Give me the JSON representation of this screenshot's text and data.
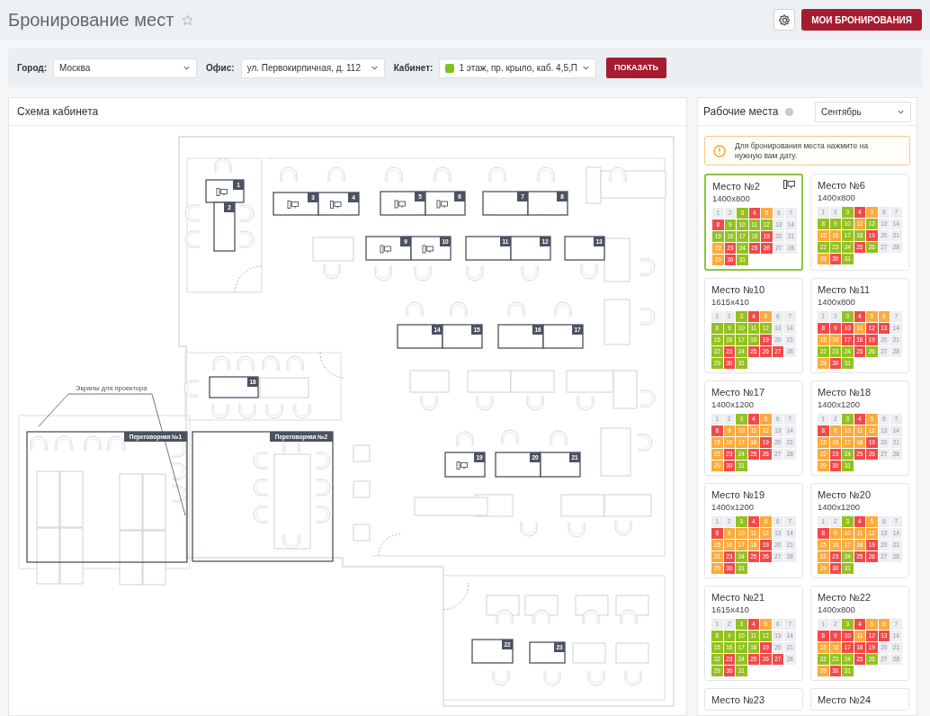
{
  "page": {
    "title": "Бронирование мест",
    "favorite": false,
    "my_bookings_button": "МОИ БРОНИРОВАНИЯ"
  },
  "filters": [
    {
      "label": "Город:",
      "value": "Москва"
    },
    {
      "label": "Офис:",
      "value": "ул. Первокирпичная, д. 112"
    },
    {
      "label": "Кабинет:",
      "value": "1 этаж, пр. крыло, каб. 4,5,П",
      "color": "#7cc520"
    }
  ],
  "show_button": "ПОКАЗАТЬ",
  "plan": {
    "title": "Схема кабинета",
    "annotation": "Экраны для проектора",
    "rooms": [
      {
        "label": "Переговорная №1"
      },
      {
        "label": "Переговорная №2"
      }
    ],
    "desks": [
      {
        "number": "1",
        "monitor": true
      },
      {
        "number": "2",
        "monitor": false
      },
      {
        "number": "3",
        "monitor": true
      },
      {
        "number": "4",
        "monitor": true
      },
      {
        "number": "5",
        "monitor": true
      },
      {
        "number": "6",
        "monitor": true
      },
      {
        "number": "7",
        "monitor": false
      },
      {
        "number": "8",
        "monitor": false
      },
      {
        "number": "9",
        "monitor": true
      },
      {
        "number": "10",
        "monitor": true
      },
      {
        "number": "11",
        "monitor": false
      },
      {
        "number": "12",
        "monitor": false
      },
      {
        "number": "13",
        "monitor": false
      },
      {
        "number": "14",
        "monitor": false
      },
      {
        "number": "15",
        "monitor": false
      },
      {
        "number": "16",
        "monitor": false
      },
      {
        "number": "17",
        "monitor": false
      },
      {
        "number": "18",
        "monitor": false
      },
      {
        "number": "19",
        "monitor": true
      },
      {
        "number": "20",
        "monitor": false
      },
      {
        "number": "21",
        "monitor": false
      },
      {
        "number": "22",
        "monitor": false
      },
      {
        "number": "23",
        "monitor": false
      }
    ]
  },
  "workplaces": {
    "title": "Рабочие места",
    "month": "Сентябрь",
    "notice": "Для бронирования места нажмите на нужную вам дату.",
    "cards": [
      {
        "title": "Место №2",
        "size": "1400x800",
        "selected": true,
        "monitor": true,
        "days": [
          {
            "n": "1",
            "color": "#eceef1"
          },
          {
            "n": "2",
            "color": "#eceef1"
          },
          {
            "n": "3",
            "color": "#94c11f"
          },
          {
            "n": "4",
            "color": "#f24a4a"
          },
          {
            "n": "5",
            "color": "#fbab3c"
          },
          {
            "n": "6",
            "color": "#eceef1"
          },
          {
            "n": "7",
            "color": "#eceef1"
          },
          {
            "n": "8",
            "color": "#f24a4a"
          },
          {
            "n": "9",
            "color": "#94c11f"
          },
          {
            "n": "10",
            "color": "#94c11f"
          },
          {
            "n": "11",
            "color": "#94c11f"
          },
          {
            "n": "12",
            "color": "#94c11f"
          },
          {
            "n": "13",
            "color": "#eceef1"
          },
          {
            "n": "14",
            "color": "#eceef1"
          },
          {
            "n": "15",
            "color": "#94c11f"
          },
          {
            "n": "16",
            "color": "#94c11f"
          },
          {
            "n": "17",
            "color": "#94c11f"
          },
          {
            "n": "18",
            "color": "#94c11f"
          },
          {
            "n": "19",
            "color": "#f24a4a"
          },
          {
            "n": "20",
            "color": "#eceef1"
          },
          {
            "n": "21",
            "color": "#eceef1"
          },
          {
            "n": "22",
            "color": "#fbab3c"
          },
          {
            "n": "23",
            "color": "#f24a4a"
          },
          {
            "n": "24",
            "color": "#94c11f"
          },
          {
            "n": "25",
            "color": "#f24a4a"
          },
          {
            "n": "26",
            "color": "#f24a4a"
          },
          {
            "n": "27",
            "color": "#eceef1"
          },
          {
            "n": "28",
            "color": "#eceef1"
          },
          {
            "n": "29",
            "color": "#fbab3c"
          },
          {
            "n": "30",
            "color": "#f24a4a"
          },
          {
            "n": "31",
            "color": "#94c11f"
          }
        ]
      },
      {
        "title": "Место №6",
        "size": "1400x800",
        "selected": false,
        "monitor": false,
        "days": [
          {
            "n": "1",
            "color": "#eceef1"
          },
          {
            "n": "2",
            "color": "#eceef1"
          },
          {
            "n": "3",
            "color": "#94c11f"
          },
          {
            "n": "4",
            "color": "#f24a4a"
          },
          {
            "n": "5",
            "color": "#fbab3c"
          },
          {
            "n": "6",
            "color": "#eceef1"
          },
          {
            "n": "7",
            "color": "#eceef1"
          },
          {
            "n": "8",
            "color": "#94c11f"
          },
          {
            "n": "9",
            "color": "#94c11f"
          },
          {
            "n": "10",
            "color": "#94c11f"
          },
          {
            "n": "11",
            "color": "#fbab3c"
          },
          {
            "n": "12",
            "color": "#94c11f"
          },
          {
            "n": "13",
            "color": "#eceef1"
          },
          {
            "n": "14",
            "color": "#eceef1"
          },
          {
            "n": "15",
            "color": "#fbab3c"
          },
          {
            "n": "16",
            "color": "#fbab3c"
          },
          {
            "n": "17",
            "color": "#94c11f"
          },
          {
            "n": "18",
            "color": "#94c11f"
          },
          {
            "n": "19",
            "color": "#f24a4a"
          },
          {
            "n": "20",
            "color": "#eceef1"
          },
          {
            "n": "21",
            "color": "#eceef1"
          },
          {
            "n": "22",
            "color": "#94c11f"
          },
          {
            "n": "23",
            "color": "#94c11f"
          },
          {
            "n": "24",
            "color": "#94c11f"
          },
          {
            "n": "25",
            "color": "#f24a4a"
          },
          {
            "n": "26",
            "color": "#94c11f"
          },
          {
            "n": "27",
            "color": "#eceef1"
          },
          {
            "n": "28",
            "color": "#eceef1"
          },
          {
            "n": "29",
            "color": "#fbab3c"
          },
          {
            "n": "30",
            "color": "#f24a4a"
          },
          {
            "n": "31",
            "color": "#94c11f"
          }
        ]
      },
      {
        "title": "Место №10",
        "size": "1615x410",
        "selected": false,
        "monitor": false,
        "days": [
          {
            "n": "1",
            "color": "#eceef1"
          },
          {
            "n": "2",
            "color": "#eceef1"
          },
          {
            "n": "3",
            "color": "#94c11f"
          },
          {
            "n": "4",
            "color": "#f24a4a"
          },
          {
            "n": "5",
            "color": "#fbab3c"
          },
          {
            "n": "6",
            "color": "#eceef1"
          },
          {
            "n": "7",
            "color": "#eceef1"
          },
          {
            "n": "8",
            "color": "#94c11f"
          },
          {
            "n": "9",
            "color": "#94c11f"
          },
          {
            "n": "10",
            "color": "#94c11f"
          },
          {
            "n": "11",
            "color": "#94c11f"
          },
          {
            "n": "12",
            "color": "#94c11f"
          },
          {
            "n": "13",
            "color": "#eceef1"
          },
          {
            "n": "14",
            "color": "#eceef1"
          },
          {
            "n": "15",
            "color": "#94c11f"
          },
          {
            "n": "16",
            "color": "#94c11f"
          },
          {
            "n": "17",
            "color": "#94c11f"
          },
          {
            "n": "18",
            "color": "#94c11f"
          },
          {
            "n": "19",
            "color": "#f24a4a"
          },
          {
            "n": "20",
            "color": "#eceef1"
          },
          {
            "n": "21",
            "color": "#eceef1"
          },
          {
            "n": "22",
            "color": "#94c11f"
          },
          {
            "n": "23",
            "color": "#f24a4a"
          },
          {
            "n": "24",
            "color": "#94c11f"
          },
          {
            "n": "25",
            "color": "#f24a4a"
          },
          {
            "n": "26",
            "color": "#f24a4a"
          },
          {
            "n": "27",
            "color": "#f24a4a"
          },
          {
            "n": "28",
            "color": "#eceef1"
          },
          {
            "n": "29",
            "color": "#94c11f"
          },
          {
            "n": "30",
            "color": "#f24a4a"
          },
          {
            "n": "31",
            "color": "#94c11f"
          }
        ]
      },
      {
        "title": "Место №11",
        "size": "1400x800",
        "selected": false,
        "monitor": false,
        "days": [
          {
            "n": "1",
            "color": "#eceef1"
          },
          {
            "n": "2",
            "color": "#eceef1"
          },
          {
            "n": "3",
            "color": "#94c11f"
          },
          {
            "n": "4",
            "color": "#f24a4a"
          },
          {
            "n": "5",
            "color": "#fbab3c"
          },
          {
            "n": "6",
            "color": "#fbab3c"
          },
          {
            "n": "7",
            "color": "#eceef1"
          },
          {
            "n": "8",
            "color": "#f24a4a"
          },
          {
            "n": "9",
            "color": "#f24a4a"
          },
          {
            "n": "10",
            "color": "#f24a4a"
          },
          {
            "n": "11",
            "color": "#fbab3c"
          },
          {
            "n": "12",
            "color": "#f24a4a"
          },
          {
            "n": "13",
            "color": "#f24a4a"
          },
          {
            "n": "14",
            "color": "#eceef1"
          },
          {
            "n": "15",
            "color": "#fbab3c"
          },
          {
            "n": "16",
            "color": "#fbab3c"
          },
          {
            "n": "17",
            "color": "#f24a4a"
          },
          {
            "n": "18",
            "color": "#f24a4a"
          },
          {
            "n": "19",
            "color": "#f24a4a"
          },
          {
            "n": "20",
            "color": "#eceef1"
          },
          {
            "n": "21",
            "color": "#eceef1"
          },
          {
            "n": "22",
            "color": "#94c11f"
          },
          {
            "n": "23",
            "color": "#94c11f"
          },
          {
            "n": "24",
            "color": "#94c11f"
          },
          {
            "n": "25",
            "color": "#f24a4a"
          },
          {
            "n": "26",
            "color": "#94c11f"
          },
          {
            "n": "27",
            "color": "#eceef1"
          },
          {
            "n": "28",
            "color": "#eceef1"
          },
          {
            "n": "29",
            "color": "#fbab3c"
          },
          {
            "n": "30",
            "color": "#f24a4a"
          },
          {
            "n": "31",
            "color": "#94c11f"
          }
        ]
      },
      {
        "title": "Место №17",
        "size": "1400x1200",
        "selected": false,
        "monitor": false,
        "days": [
          {
            "n": "1",
            "color": "#eceef1"
          },
          {
            "n": "2",
            "color": "#eceef1"
          },
          {
            "n": "3",
            "color": "#94c11f"
          },
          {
            "n": "4",
            "color": "#f24a4a"
          },
          {
            "n": "5",
            "color": "#fbab3c"
          },
          {
            "n": "6",
            "color": "#eceef1"
          },
          {
            "n": "7",
            "color": "#eceef1"
          },
          {
            "n": "8",
            "color": "#f24a4a"
          },
          {
            "n": "9",
            "color": "#fbab3c"
          },
          {
            "n": "10",
            "color": "#fbab3c"
          },
          {
            "n": "11",
            "color": "#fbab3c"
          },
          {
            "n": "12",
            "color": "#fbab3c"
          },
          {
            "n": "13",
            "color": "#eceef1"
          },
          {
            "n": "14",
            "color": "#eceef1"
          },
          {
            "n": "15",
            "color": "#fbab3c"
          },
          {
            "n": "16",
            "color": "#fbab3c"
          },
          {
            "n": "17",
            "color": "#fbab3c"
          },
          {
            "n": "18",
            "color": "#fbab3c"
          },
          {
            "n": "19",
            "color": "#f24a4a"
          },
          {
            "n": "20",
            "color": "#eceef1"
          },
          {
            "n": "21",
            "color": "#eceef1"
          },
          {
            "n": "22",
            "color": "#fbab3c"
          },
          {
            "n": "23",
            "color": "#f24a4a"
          },
          {
            "n": "24",
            "color": "#94c11f"
          },
          {
            "n": "25",
            "color": "#f24a4a"
          },
          {
            "n": "26",
            "color": "#f24a4a"
          },
          {
            "n": "27",
            "color": "#eceef1"
          },
          {
            "n": "28",
            "color": "#eceef1"
          },
          {
            "n": "29",
            "color": "#fbab3c"
          },
          {
            "n": "30",
            "color": "#f24a4a"
          },
          {
            "n": "31",
            "color": "#94c11f"
          }
        ]
      },
      {
        "title": "Место №18",
        "size": "1400x1200",
        "selected": false,
        "monitor": false,
        "days": [
          {
            "n": "1",
            "color": "#eceef1"
          },
          {
            "n": "2",
            "color": "#eceef1"
          },
          {
            "n": "3",
            "color": "#94c11f"
          },
          {
            "n": "4",
            "color": "#f24a4a"
          },
          {
            "n": "5",
            "color": "#fbab3c"
          },
          {
            "n": "6",
            "color": "#eceef1"
          },
          {
            "n": "7",
            "color": "#eceef1"
          },
          {
            "n": "8",
            "color": "#f24a4a"
          },
          {
            "n": "9",
            "color": "#fbab3c"
          },
          {
            "n": "10",
            "color": "#fbab3c"
          },
          {
            "n": "11",
            "color": "#fbab3c"
          },
          {
            "n": "12",
            "color": "#fbab3c"
          },
          {
            "n": "13",
            "color": "#eceef1"
          },
          {
            "n": "14",
            "color": "#eceef1"
          },
          {
            "n": "15",
            "color": "#fbab3c"
          },
          {
            "n": "16",
            "color": "#fbab3c"
          },
          {
            "n": "17",
            "color": "#fbab3c"
          },
          {
            "n": "18",
            "color": "#fbab3c"
          },
          {
            "n": "19",
            "color": "#f24a4a"
          },
          {
            "n": "20",
            "color": "#eceef1"
          },
          {
            "n": "21",
            "color": "#eceef1"
          },
          {
            "n": "22",
            "color": "#fbab3c"
          },
          {
            "n": "23",
            "color": "#f24a4a"
          },
          {
            "n": "24",
            "color": "#94c11f"
          },
          {
            "n": "25",
            "color": "#f24a4a"
          },
          {
            "n": "26",
            "color": "#f24a4a"
          },
          {
            "n": "27",
            "color": "#eceef1"
          },
          {
            "n": "28",
            "color": "#eceef1"
          },
          {
            "n": "29",
            "color": "#fbab3c"
          },
          {
            "n": "30",
            "color": "#f24a4a"
          },
          {
            "n": "31",
            "color": "#94c11f"
          }
        ]
      },
      {
        "title": "Место №19",
        "size": "1400x1200",
        "selected": false,
        "monitor": false,
        "days": [
          {
            "n": "1",
            "color": "#eceef1"
          },
          {
            "n": "2",
            "color": "#eceef1"
          },
          {
            "n": "3",
            "color": "#94c11f"
          },
          {
            "n": "4",
            "color": "#f24a4a"
          },
          {
            "n": "5",
            "color": "#fbab3c"
          },
          {
            "n": "6",
            "color": "#eceef1"
          },
          {
            "n": "7",
            "color": "#eceef1"
          },
          {
            "n": "8",
            "color": "#f24a4a"
          },
          {
            "n": "9",
            "color": "#fbab3c"
          },
          {
            "n": "10",
            "color": "#fbab3c"
          },
          {
            "n": "11",
            "color": "#fbab3c"
          },
          {
            "n": "12",
            "color": "#fbab3c"
          },
          {
            "n": "13",
            "color": "#eceef1"
          },
          {
            "n": "14",
            "color": "#eceef1"
          },
          {
            "n": "15",
            "color": "#fbab3c"
          },
          {
            "n": "16",
            "color": "#fbab3c"
          },
          {
            "n": "17",
            "color": "#fbab3c"
          },
          {
            "n": "18",
            "color": "#fbab3c"
          },
          {
            "n": "19",
            "color": "#f24a4a"
          },
          {
            "n": "20",
            "color": "#eceef1"
          },
          {
            "n": "21",
            "color": "#eceef1"
          },
          {
            "n": "22",
            "color": "#fbab3c"
          },
          {
            "n": "23",
            "color": "#f24a4a"
          },
          {
            "n": "24",
            "color": "#94c11f"
          },
          {
            "n": "25",
            "color": "#f24a4a"
          },
          {
            "n": "26",
            "color": "#f24a4a"
          },
          {
            "n": "27",
            "color": "#eceef1"
          },
          {
            "n": "28",
            "color": "#eceef1"
          },
          {
            "n": "29",
            "color": "#fbab3c"
          },
          {
            "n": "30",
            "color": "#f24a4a"
          },
          {
            "n": "31",
            "color": "#94c11f"
          }
        ]
      },
      {
        "title": "Место №20",
        "size": "1400x1200",
        "selected": false,
        "monitor": false,
        "days": [
          {
            "n": "1",
            "color": "#eceef1"
          },
          {
            "n": "2",
            "color": "#eceef1"
          },
          {
            "n": "3",
            "color": "#94c11f"
          },
          {
            "n": "4",
            "color": "#f24a4a"
          },
          {
            "n": "5",
            "color": "#fbab3c"
          },
          {
            "n": "6",
            "color": "#eceef1"
          },
          {
            "n": "7",
            "color": "#eceef1"
          },
          {
            "n": "8",
            "color": "#f24a4a"
          },
          {
            "n": "9",
            "color": "#fbab3c"
          },
          {
            "n": "10",
            "color": "#fbab3c"
          },
          {
            "n": "11",
            "color": "#fbab3c"
          },
          {
            "n": "12",
            "color": "#fbab3c"
          },
          {
            "n": "13",
            "color": "#eceef1"
          },
          {
            "n": "14",
            "color": "#eceef1"
          },
          {
            "n": "15",
            "color": "#fbab3c"
          },
          {
            "n": "16",
            "color": "#fbab3c"
          },
          {
            "n": "17",
            "color": "#fbab3c"
          },
          {
            "n": "18",
            "color": "#fbab3c"
          },
          {
            "n": "19",
            "color": "#f24a4a"
          },
          {
            "n": "20",
            "color": "#eceef1"
          },
          {
            "n": "21",
            "color": "#eceef1"
          },
          {
            "n": "22",
            "color": "#fbab3c"
          },
          {
            "n": "23",
            "color": "#f24a4a"
          },
          {
            "n": "24",
            "color": "#94c11f"
          },
          {
            "n": "25",
            "color": "#f24a4a"
          },
          {
            "n": "26",
            "color": "#f24a4a"
          },
          {
            "n": "27",
            "color": "#eceef1"
          },
          {
            "n": "28",
            "color": "#eceef1"
          },
          {
            "n": "29",
            "color": "#fbab3c"
          },
          {
            "n": "30",
            "color": "#f24a4a"
          },
          {
            "n": "31",
            "color": "#94c11f"
          }
        ]
      },
      {
        "title": "Место №21",
        "size": "1615x410",
        "selected": false,
        "monitor": false,
        "days": [
          {
            "n": "1",
            "color": "#eceef1"
          },
          {
            "n": "2",
            "color": "#eceef1"
          },
          {
            "n": "3",
            "color": "#94c11f"
          },
          {
            "n": "4",
            "color": "#f24a4a"
          },
          {
            "n": "5",
            "color": "#fbab3c"
          },
          {
            "n": "6",
            "color": "#eceef1"
          },
          {
            "n": "7",
            "color": "#eceef1"
          },
          {
            "n": "8",
            "color": "#94c11f"
          },
          {
            "n": "9",
            "color": "#94c11f"
          },
          {
            "n": "10",
            "color": "#94c11f"
          },
          {
            "n": "11",
            "color": "#94c11f"
          },
          {
            "n": "12",
            "color": "#94c11f"
          },
          {
            "n": "13",
            "color": "#eceef1"
          },
          {
            "n": "14",
            "color": "#eceef1"
          },
          {
            "n": "15",
            "color": "#94c11f"
          },
          {
            "n": "16",
            "color": "#94c11f"
          },
          {
            "n": "17",
            "color": "#94c11f"
          },
          {
            "n": "18",
            "color": "#94c11f"
          },
          {
            "n": "19",
            "color": "#f24a4a"
          },
          {
            "n": "20",
            "color": "#eceef1"
          },
          {
            "n": "21",
            "color": "#eceef1"
          },
          {
            "n": "22",
            "color": "#94c11f"
          },
          {
            "n": "23",
            "color": "#f24a4a"
          },
          {
            "n": "24",
            "color": "#94c11f"
          },
          {
            "n": "25",
            "color": "#f24a4a"
          },
          {
            "n": "26",
            "color": "#f24a4a"
          },
          {
            "n": "27",
            "color": "#f24a4a"
          },
          {
            "n": "28",
            "color": "#eceef1"
          },
          {
            "n": "29",
            "color": "#94c11f"
          },
          {
            "n": "30",
            "color": "#f24a4a"
          },
          {
            "n": "31",
            "color": "#94c11f"
          }
        ]
      },
      {
        "title": "Место №22",
        "size": "1400x800",
        "selected": false,
        "monitor": false,
        "days": [
          {
            "n": "1",
            "color": "#eceef1"
          },
          {
            "n": "2",
            "color": "#eceef1"
          },
          {
            "n": "3",
            "color": "#94c11f"
          },
          {
            "n": "4",
            "color": "#f24a4a"
          },
          {
            "n": "5",
            "color": "#fbab3c"
          },
          {
            "n": "6",
            "color": "#fbab3c"
          },
          {
            "n": "7",
            "color": "#eceef1"
          },
          {
            "n": "8",
            "color": "#f24a4a"
          },
          {
            "n": "9",
            "color": "#f24a4a"
          },
          {
            "n": "10",
            "color": "#f24a4a"
          },
          {
            "n": "11",
            "color": "#fbab3c"
          },
          {
            "n": "12",
            "color": "#f24a4a"
          },
          {
            "n": "13",
            "color": "#f24a4a"
          },
          {
            "n": "14",
            "color": "#eceef1"
          },
          {
            "n": "15",
            "color": "#fbab3c"
          },
          {
            "n": "16",
            "color": "#fbab3c"
          },
          {
            "n": "17",
            "color": "#f24a4a"
          },
          {
            "n": "18",
            "color": "#f24a4a"
          },
          {
            "n": "19",
            "color": "#f24a4a"
          },
          {
            "n": "20",
            "color": "#eceef1"
          },
          {
            "n": "21",
            "color": "#eceef1"
          },
          {
            "n": "22",
            "color": "#94c11f"
          },
          {
            "n": "23",
            "color": "#94c11f"
          },
          {
            "n": "24",
            "color": "#94c11f"
          },
          {
            "n": "25",
            "color": "#f24a4a"
          },
          {
            "n": "26",
            "color": "#94c11f"
          },
          {
            "n": "27",
            "color": "#eceef1"
          },
          {
            "n": "28",
            "color": "#eceef1"
          },
          {
            "n": "29",
            "color": "#fbab3c"
          },
          {
            "n": "30",
            "color": "#f24a4a"
          },
          {
            "n": "31",
            "color": "#94c11f"
          }
        ]
      },
      {
        "title": "Место №23",
        "selected": false
      },
      {
        "title": "Место №24",
        "selected": false
      }
    ]
  }
}
